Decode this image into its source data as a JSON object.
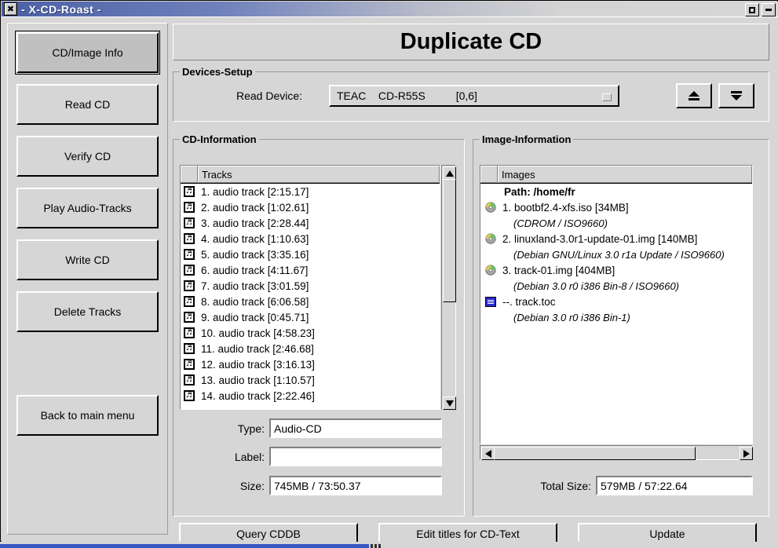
{
  "window": {
    "title": "- X-CD-Roast -",
    "close_icon": "✖",
    "maximize_label": "maximize",
    "minimize_label": "minimize"
  },
  "page": {
    "title": "Duplicate CD"
  },
  "sidebar": {
    "items": [
      {
        "label": "CD/Image Info",
        "selected": true
      },
      {
        "label": "Read CD",
        "selected": false
      },
      {
        "label": "Verify CD",
        "selected": false
      },
      {
        "label": "Play Audio-Tracks",
        "selected": false
      },
      {
        "label": "Write CD",
        "selected": false
      },
      {
        "label": "Delete Tracks",
        "selected": false
      }
    ],
    "back_button": "Back to main menu"
  },
  "devices_setup": {
    "group_label": "Devices-Setup",
    "read_device_label": "Read Device:",
    "read_device_value": "TEAC    CD-R55S          [0,6]",
    "eject_icon": "eject-icon",
    "load_icon": "load-tray-icon"
  },
  "cd_information": {
    "group_label": "CD-Information",
    "column_header": "Tracks",
    "tracks": [
      "1. audio track [2:15.17]",
      "2. audio track [1:02.61]",
      "3. audio track [2:28.44]",
      "4. audio track [1:10.63]",
      "5. audio track [3:35.16]",
      "6. audio track [4:11.67]",
      "7. audio track [3:01.59]",
      "8. audio track [6:06.58]",
      "9. audio track [0:45.71]",
      "10. audio track [4:58.23]",
      "11. audio track [2:46.68]",
      "12. audio track [3:16.13]",
      "13. audio track [1:10.57]",
      "14. audio track [2:22.46]"
    ],
    "track_icon": "♬",
    "type_label": "Type:",
    "type_value": "Audio-CD",
    "label_label": "Label:",
    "label_value": "",
    "label_placeholder": "",
    "size_label": "Size:",
    "size_value": "745MB / 73:50.37"
  },
  "image_information": {
    "group_label": "Image-Information",
    "column_header": "Images",
    "path_line": "Path: /home/fr",
    "entries": [
      {
        "icon": "cd-disc-icon",
        "name": "1. bootbf2.4-xfs.iso [34MB]",
        "detail": "(CDROM / ISO9660)"
      },
      {
        "icon": "cd-disc-icon",
        "name": "2. linuxland-3.0r1-update-01.img [140MB]",
        "detail": "(Debian GNU/Linux 3.0 r1a Update  / ISO9660)"
      },
      {
        "icon": "cd-disc-icon",
        "name": "3. track-01.img [404MB]",
        "detail": "(Debian 3.0 r0 i386 Bin-8 / ISO9660)"
      },
      {
        "icon": "toc-file-icon",
        "name": "--. track.toc",
        "detail": "(Debian 3.0 r0 i386 Bin-1)"
      }
    ],
    "total_size_label": "Total Size:",
    "total_size_value": "579MB / 57:22.64"
  },
  "bottom_buttons": {
    "query_cddb": "Query CDDB",
    "edit_titles": "Edit titles for CD-Text",
    "update": "Update"
  },
  "colors": {
    "face": "#d6d6d6",
    "title_blue": "#4a5fa5",
    "taskbar_blue": "#3b57c4",
    "white": "#ffffff",
    "shadow": "#808080"
  }
}
